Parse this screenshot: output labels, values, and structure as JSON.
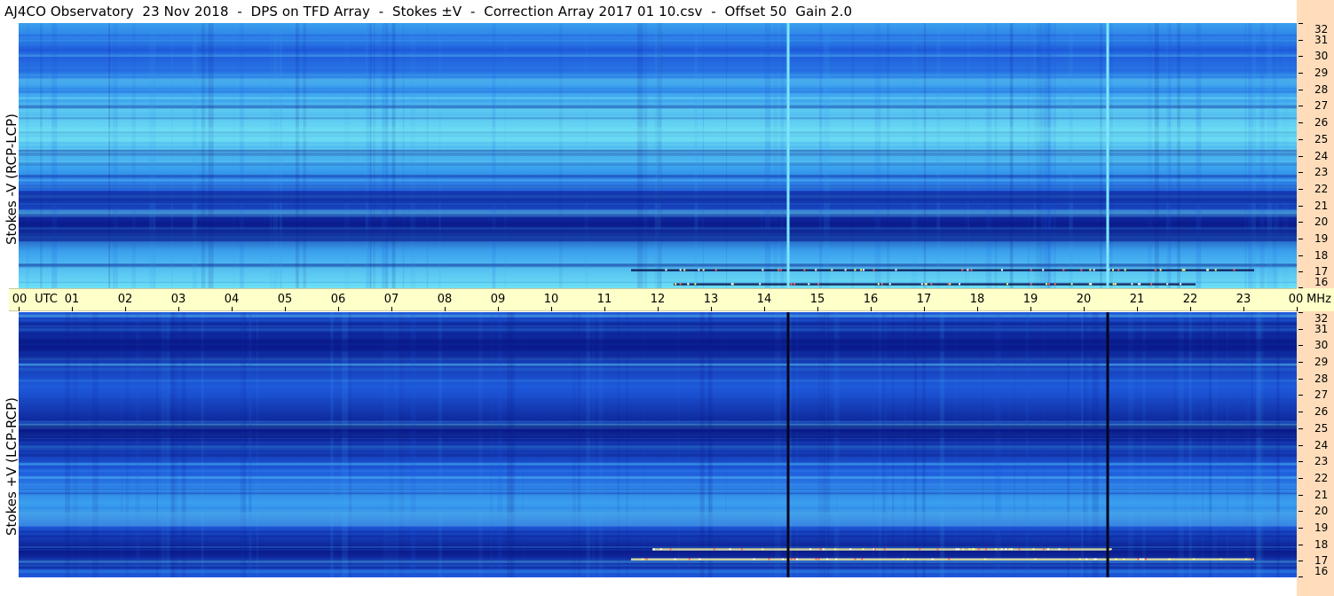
{
  "title": "AJ4CO Observatory  23 Nov 2018  -  DPS on TFD Array  -  Stokes ±V  -  Correction Array 2017 01 10.csv  -  Offset 50  Gain 2.0",
  "panels": {
    "top": {
      "label": "Stokes -V (RCP-LCP)"
    },
    "bottom": {
      "label": "Stokes +V (LCP-RCP)"
    }
  },
  "colors": {
    "frame_right": "#ffddbb",
    "time_bar": "#ffffc9"
  },
  "chart_data": [
    {
      "type": "heatmap",
      "title": "",
      "xlabel": "UTC",
      "ylabel": "Stokes -V (RCP-LCP)",
      "x_unit": "UTC hour",
      "y_unit": "MHz",
      "xlim": [
        0,
        24
      ],
      "ylim": [
        16,
        32
      ],
      "x_ticks": [
        "00",
        "01",
        "02",
        "03",
        "04",
        "05",
        "06",
        "07",
        "08",
        "09",
        "10",
        "11",
        "12",
        "13",
        "14",
        "15",
        "16",
        "17",
        "18",
        "19",
        "20",
        "21",
        "22",
        "23",
        "00"
      ],
      "y_ticks": [
        "16",
        "17",
        "18",
        "19",
        "20",
        "21",
        "22",
        "23",
        "24",
        "25",
        "26",
        "27",
        "28",
        "29",
        "30",
        "31",
        "32"
      ],
      "vertical_lines_utc": [
        14.45,
        20.45
      ],
      "colormap": [
        "#0a1a8a",
        "#1e5adc",
        "#3aa0ee",
        "#6ee0f4"
      ],
      "features": [
        {
          "type": "dark_band",
          "freq_mhz": 19.2
        },
        {
          "type": "dark_band",
          "freq_mhz": 21.5
        },
        {
          "type": "bright_band",
          "freq_mhz": 25.3
        },
        {
          "type": "burst_line",
          "freq_mhz": 17.1,
          "start_utc": 11.5,
          "end_utc": 23.2
        },
        {
          "type": "burst_line",
          "freq_mhz": 16.25,
          "start_utc": 12.3,
          "end_utc": 22.1
        }
      ]
    },
    {
      "type": "heatmap",
      "title": "",
      "xlabel": "UTC",
      "ylabel": "Stokes +V (LCP-RCP)",
      "x_unit": "UTC hour",
      "y_unit": "MHz",
      "xlim": [
        0,
        24
      ],
      "ylim": [
        16,
        32
      ],
      "x_ticks": [
        "00",
        "01",
        "02",
        "03",
        "04",
        "05",
        "06",
        "07",
        "08",
        "09",
        "10",
        "11",
        "12",
        "13",
        "14",
        "15",
        "16",
        "17",
        "18",
        "19",
        "20",
        "21",
        "22",
        "23",
        "00"
      ],
      "y_ticks": [
        "16",
        "17",
        "18",
        "19",
        "20",
        "21",
        "22",
        "23",
        "24",
        "25",
        "26",
        "27",
        "28",
        "29",
        "30",
        "31",
        "32"
      ],
      "vertical_lines_utc": [
        14.45,
        20.45
      ],
      "colormap": [
        "#0a1a8a",
        "#1e5adc",
        "#3aa0ee",
        "#6ee0f4"
      ],
      "features": [
        {
          "type": "dark_band",
          "freq_mhz": 24.8
        },
        {
          "type": "dark_band",
          "freq_mhz": 30.0
        },
        {
          "type": "bright_band",
          "freq_mhz": 19.5
        },
        {
          "type": "burst_line",
          "freq_mhz": 17.7,
          "start_utc": 11.9,
          "end_utc": 20.5
        },
        {
          "type": "burst_line",
          "freq_mhz": 17.1,
          "start_utc": 11.5,
          "end_utc": 23.2
        }
      ]
    }
  ],
  "axis": {
    "utc_label": "UTC",
    "mhz_label": "MHz"
  }
}
